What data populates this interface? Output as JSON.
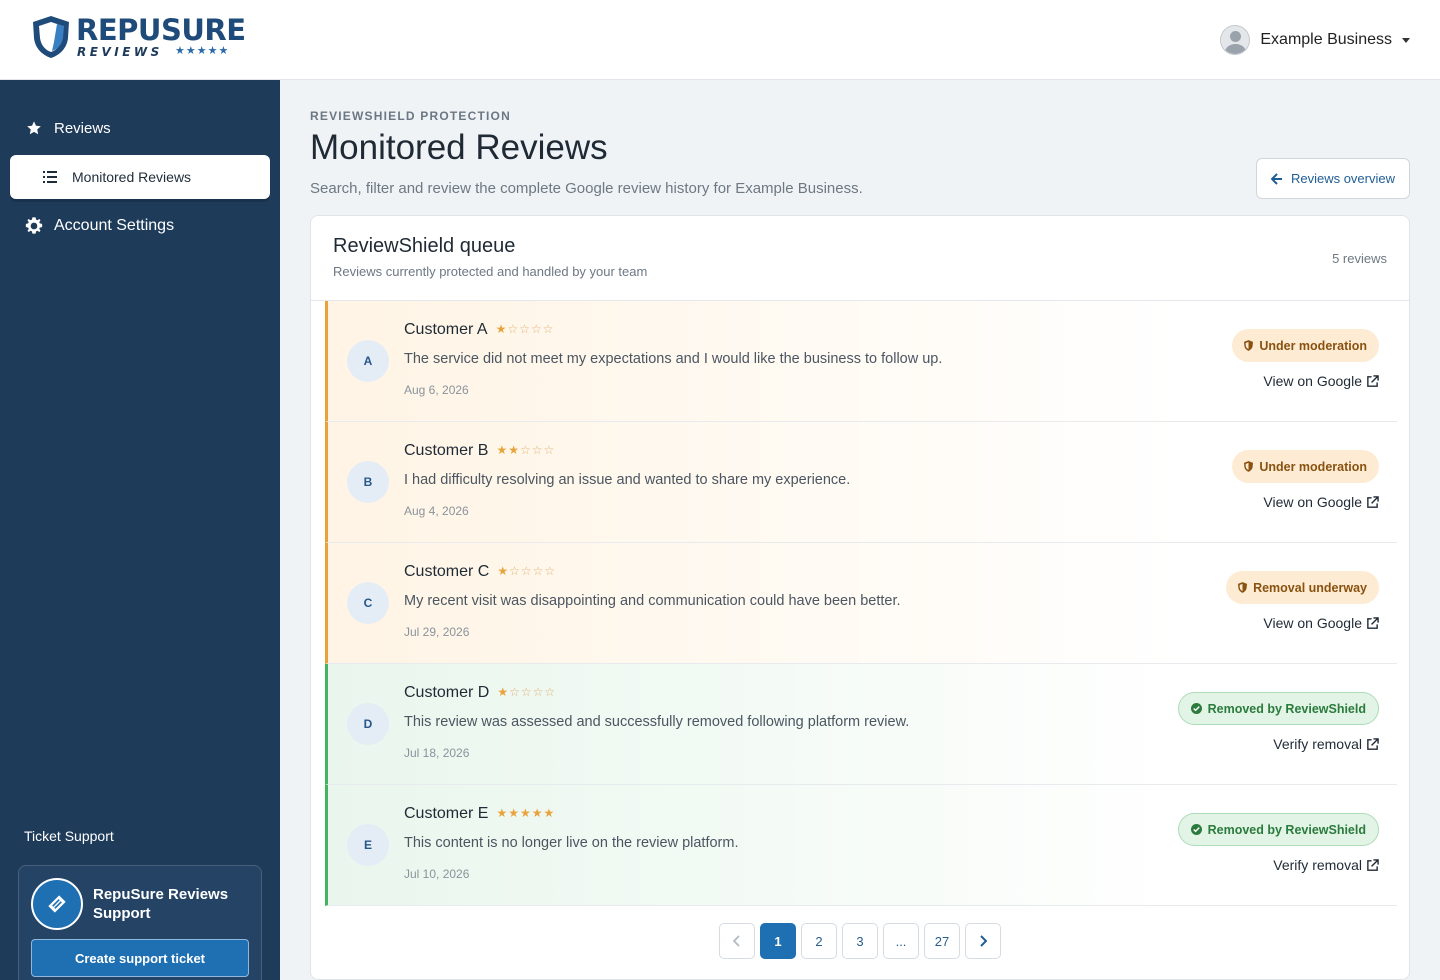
{
  "brand": {
    "word": "REPUSURE",
    "sub": "REVIEWS",
    "stars": "★★★★★"
  },
  "header": {
    "user_name": "Example Business"
  },
  "sidebar": {
    "items": [
      {
        "label": "Reviews",
        "icon": "star-icon"
      },
      {
        "label": "Monitored Reviews",
        "icon": "list-icon",
        "active": true
      },
      {
        "label": "Account Settings",
        "icon": "gear-icon"
      }
    ],
    "ticket_label": "Ticket Support",
    "support_name": "RepuSure Reviews Support",
    "support_button": "Create support ticket"
  },
  "page": {
    "eyebrow": "REVIEWSHIELD PROTECTION",
    "title": "Monitored Reviews",
    "subtitle": "Search, filter and review the complete Google review history for Example Business.",
    "overview_button": "Reviews overview"
  },
  "queue": {
    "title": "ReviewShield queue",
    "subtitle": "Reviews currently protected and handled by your team",
    "count": "5 reviews",
    "reviews": [
      {
        "initial": "A",
        "name": "Customer A",
        "rating": 1,
        "text": "The service did not meet my expectations and I would like the business to follow up.",
        "date": "Aug 6, 2026",
        "status": "Under moderation",
        "status_kind": "pending",
        "link": "View on Google"
      },
      {
        "initial": "B",
        "name": "Customer B",
        "rating": 2,
        "text": "I had difficulty resolving an issue and wanted to share my experience.",
        "date": "Aug 4, 2026",
        "status": "Under moderation",
        "status_kind": "pending",
        "link": "View on Google"
      },
      {
        "initial": "C",
        "name": "Customer C",
        "rating": 1,
        "text": "My recent visit was disappointing and communication could have been better.",
        "date": "Jul 29, 2026",
        "status": "Removal underway",
        "status_kind": "pending",
        "link": "View on Google"
      },
      {
        "initial": "D",
        "name": "Customer D",
        "rating": 1,
        "text": "This review was assessed and successfully removed following platform review.",
        "date": "Jul 18, 2026",
        "status": "Removed by ReviewShield",
        "status_kind": "removed",
        "link": "Verify removal"
      },
      {
        "initial": "E",
        "name": "Customer E",
        "rating": 5,
        "text": "This content is no longer live on the review platform.",
        "date": "Jul 10, 2026",
        "status": "Removed by ReviewShield",
        "status_kind": "removed",
        "link": "Verify removal"
      }
    ]
  },
  "pagination": {
    "pages": [
      "1",
      "2",
      "3",
      "...",
      "27"
    ],
    "current": "1"
  },
  "colors": {
    "sidebar": "#1e3b5a",
    "accent": "#1f6fb3",
    "pending": "#e9a23b",
    "removed": "#47b35e",
    "star": "#e8a33a"
  }
}
